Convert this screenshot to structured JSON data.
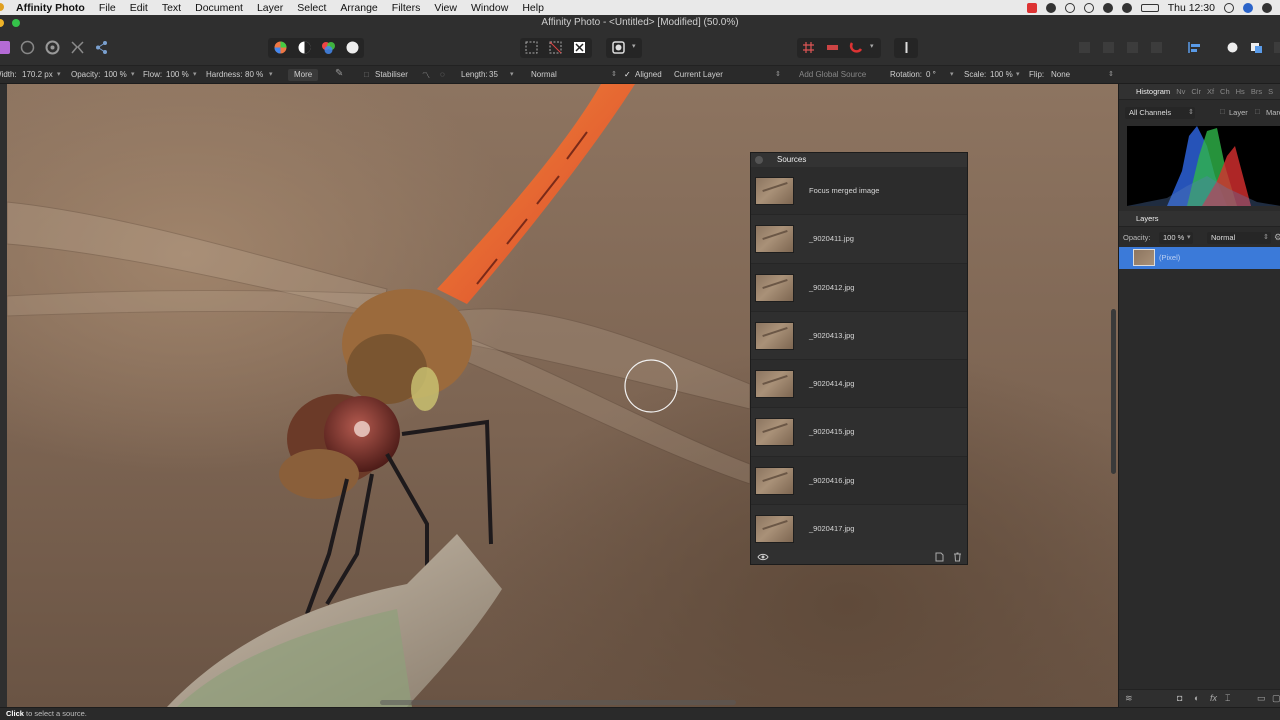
{
  "menubar": {
    "app": "Affinity Photo",
    "items": [
      "File",
      "Edit",
      "Text",
      "Document",
      "Layer",
      "Select",
      "Arrange",
      "Filters",
      "View",
      "Window",
      "Help"
    ],
    "clock": "Thu 12:30"
  },
  "window": {
    "title": "Affinity Photo - <Untitled> [Modified] (50.0%)"
  },
  "context": {
    "width_label": "Width:",
    "width_value": "170.2 px",
    "opacity_label": "Opacity:",
    "opacity_value": "100 %",
    "flow_label": "Flow:",
    "flow_value": "100 %",
    "hardness_label": "Hardness:",
    "hardness_value": "80 %",
    "more_button": "More",
    "stabiliser_label": "Stabiliser",
    "length_label": "Length:",
    "length_value": "35",
    "blend_mode": "Normal",
    "aligned_label": "Aligned",
    "source_layer": "Current Layer",
    "add_global_source": "Add Global Source",
    "rotation_label": "Rotation:",
    "rotation_value": "0 °",
    "scale_label": "Scale:",
    "scale_value": "100 %",
    "flip_label": "Flip:",
    "flip_value": "None"
  },
  "sources_panel": {
    "title": "Sources",
    "items": [
      {
        "label": "Focus merged image"
      },
      {
        "label": "_9020411.jpg"
      },
      {
        "label": "_9020412.jpg"
      },
      {
        "label": "_9020413.jpg"
      },
      {
        "label": "_9020414.jpg"
      },
      {
        "label": "_9020415.jpg"
      },
      {
        "label": "_9020416.jpg"
      },
      {
        "label": "_9020417.jpg"
      }
    ]
  },
  "right_panel": {
    "top_tabs": [
      "Histogram",
      "Nv",
      "Clr",
      "Xf",
      "Ch",
      "Hs",
      "Brs",
      "S"
    ],
    "channels": "All Channels",
    "layer_check": "Layer",
    "marquee_check": "Marq",
    "layers_tab": "Layers",
    "opacity_label": "Opacity:",
    "opacity_value": "100 %",
    "blend_mode": "Normal",
    "layer_name": "(Pixel)"
  },
  "status": {
    "bold": "Click",
    "text": " to select a source."
  },
  "colors": {
    "accent": "#3b7ad9",
    "panel": "#2b2b2b",
    "toolbar": "#2f2f2f"
  }
}
